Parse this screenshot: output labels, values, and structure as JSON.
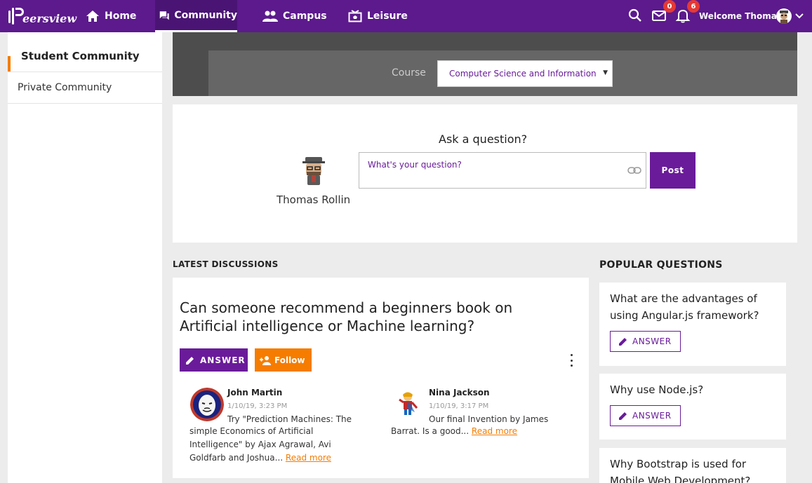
{
  "app": {
    "logo_text": "eersview"
  },
  "nav": {
    "items": [
      {
        "label": "Home",
        "icon": "home-icon"
      },
      {
        "label": "Community",
        "icon": "forum-icon",
        "active": true
      },
      {
        "label": "Campus",
        "icon": "people-icon"
      },
      {
        "label": "Leisure",
        "icon": "ticket-icon"
      }
    ],
    "messages_count": "0",
    "notifications_count": "6",
    "welcome_text": "Welcome Thomas"
  },
  "sidebar": {
    "items": [
      {
        "label": "Student Community",
        "active": true
      },
      {
        "label": "Private Community"
      }
    ]
  },
  "course": {
    "label": "Course",
    "selected": "Computer Science and Information"
  },
  "ask": {
    "title": "Ask a question?",
    "user_name": "Thomas Rollin",
    "placeholder": "What's your question?",
    "post_label": "Post"
  },
  "latest": {
    "heading": "LATEST DISCUSSIONS",
    "question": "Can someone recommend a beginners book on Artificial intelligence or Machine learning?",
    "answer_label": "ANSWER",
    "follow_label": "Follow",
    "replies": [
      {
        "name": "John Martin",
        "date": "1/10/19, 3:23 PM",
        "text_line1": "Try \"Prediction Machines: The",
        "text_rest": "simple Economics of Artificial Intelligence\" by Ajax Agrawal, Avi Goldfarb and Joshua...",
        "read_more": "Read more"
      },
      {
        "name": "Nina Jackson",
        "date": "1/10/19, 3:17 PM",
        "text_line1": "Our final Invention by James",
        "text_rest": "Barrat. Is a good...",
        "read_more": "Read more"
      }
    ]
  },
  "popular": {
    "heading": "POPULAR QUESTIONS",
    "answer_label": "ANSWER",
    "items": [
      {
        "question": "What are the advantages of using Angular.js framework?"
      },
      {
        "question": "Why use Node.js?"
      },
      {
        "question": "Why Bootstrap is used for Mobile Web Development?"
      }
    ]
  },
  "colors": {
    "primary": "#5c1a8c",
    "button_purple": "#6a1b9a",
    "accent_orange": "#f57c00",
    "badge_red": "#e53935"
  }
}
